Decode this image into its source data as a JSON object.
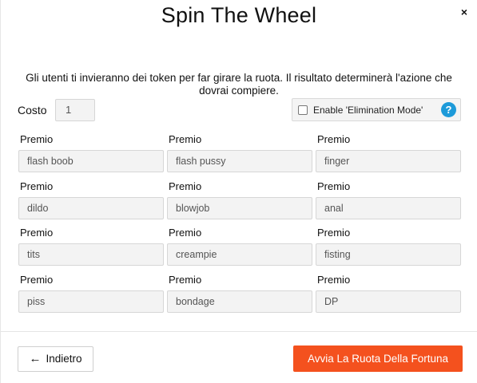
{
  "modal": {
    "title": "Spin The Wheel",
    "close_icon": "×",
    "description": "Gli utenti ti invieranno dei token per far girare la ruota. Il risultato determinerà l'azione che dovrai compiere."
  },
  "cost": {
    "label": "Costo",
    "value": "1"
  },
  "elimination": {
    "label": "Enable 'Elimination Mode'",
    "checked": false,
    "help_icon": "?"
  },
  "prizes": [
    {
      "label": "Premio",
      "value": "flash boob"
    },
    {
      "label": "Premio",
      "value": "flash pussy"
    },
    {
      "label": "Premio",
      "value": "finger"
    },
    {
      "label": "Premio",
      "value": "dildo"
    },
    {
      "label": "Premio",
      "value": "blowjob"
    },
    {
      "label": "Premio",
      "value": "anal"
    },
    {
      "label": "Premio",
      "value": "tits"
    },
    {
      "label": "Premio",
      "value": "creampie"
    },
    {
      "label": "Premio",
      "value": "fisting"
    },
    {
      "label": "Premio",
      "value": "piss"
    },
    {
      "label": "Premio",
      "value": "bondage"
    },
    {
      "label": "Premio",
      "value": "DP"
    }
  ],
  "footer": {
    "back_arrow": "←",
    "back_label": "Indietro",
    "start_label": "Avvia La Ruota Della Fortuna"
  },
  "colors": {
    "accent": "#f4511e",
    "help": "#1d9ad9"
  }
}
